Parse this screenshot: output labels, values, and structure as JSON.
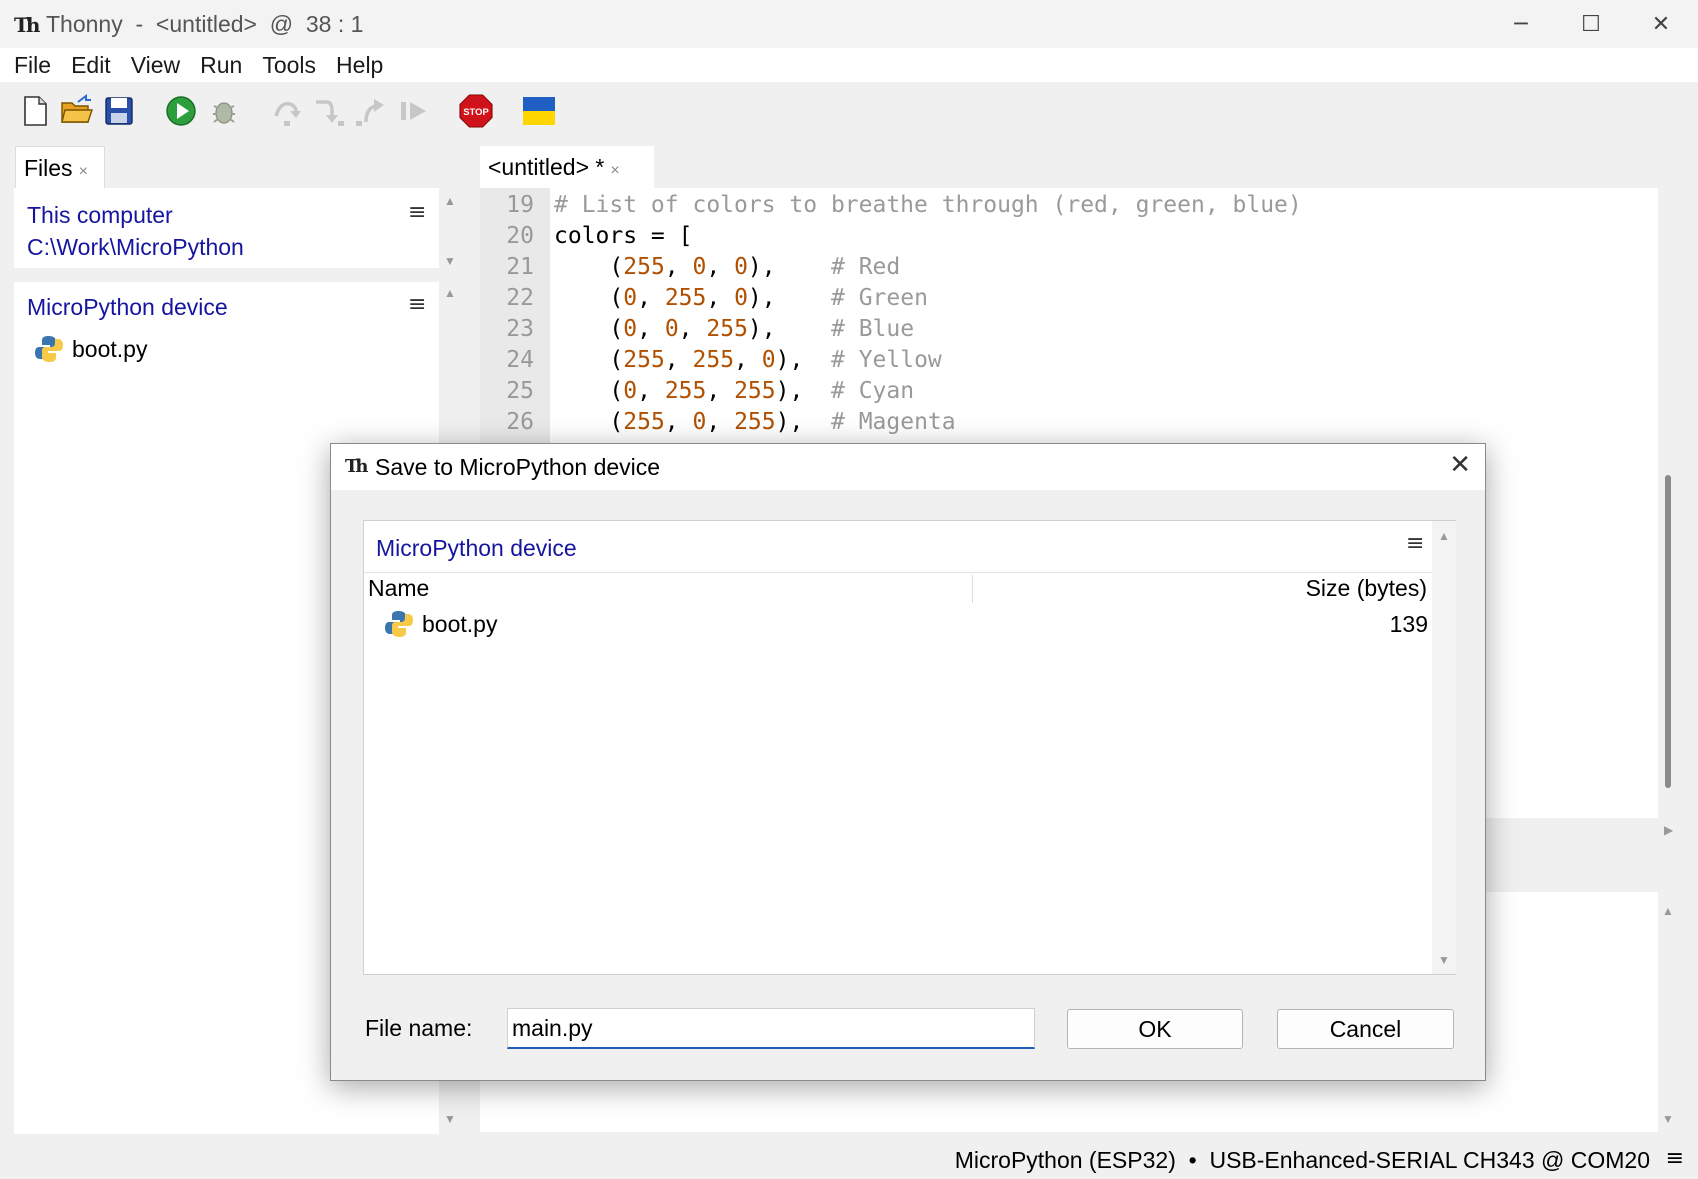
{
  "window": {
    "title": "Thonny  -  <untitled>  @  38 : 1",
    "app_icon": "Th",
    "minimize": "─",
    "maximize": "☐",
    "close": "✕"
  },
  "menu": [
    "File",
    "Edit",
    "View",
    "Run",
    "Tools",
    "Help"
  ],
  "toolbar": {
    "icons": [
      "new-file-icon",
      "open-folder-icon",
      "save-icon",
      "run-icon",
      "debug-icon",
      "step-over-icon",
      "step-into-icon",
      "step-out-icon",
      "resume-icon",
      "stop-icon",
      "ukraine-flag-icon"
    ],
    "stop_label": "STOP"
  },
  "files": {
    "tab_label": "Files",
    "tab_close": "×",
    "this_computer_label": "This computer",
    "this_computer_path": "C:\\Work\\MicroPython",
    "device_label": "MicroPython device",
    "menu_glyph": "≡",
    "items": [
      {
        "name": "boot.py",
        "icon": "python-file-icon"
      }
    ]
  },
  "editor": {
    "tab_label": "<untitled> *",
    "tab_close": "×",
    "lines": [
      {
        "n": "19",
        "parts": [
          {
            "t": "# List of colors to breathe through (red, green, blue)",
            "c": "cm"
          }
        ]
      },
      {
        "n": "20",
        "parts": [
          {
            "t": "colors = [",
            "c": ""
          }
        ]
      },
      {
        "n": "21",
        "parts": [
          {
            "t": "    (",
            "c": ""
          },
          {
            "t": "255",
            "c": "num"
          },
          {
            "t": ", ",
            "c": ""
          },
          {
            "t": "0",
            "c": "num"
          },
          {
            "t": ", ",
            "c": ""
          },
          {
            "t": "0",
            "c": "num"
          },
          {
            "t": "),    ",
            "c": ""
          },
          {
            "t": "# Red",
            "c": "cm"
          }
        ]
      },
      {
        "n": "22",
        "parts": [
          {
            "t": "    (",
            "c": ""
          },
          {
            "t": "0",
            "c": "num"
          },
          {
            "t": ", ",
            "c": ""
          },
          {
            "t": "255",
            "c": "num"
          },
          {
            "t": ", ",
            "c": ""
          },
          {
            "t": "0",
            "c": "num"
          },
          {
            "t": "),    ",
            "c": ""
          },
          {
            "t": "# Green",
            "c": "cm"
          }
        ]
      },
      {
        "n": "23",
        "parts": [
          {
            "t": "    (",
            "c": ""
          },
          {
            "t": "0",
            "c": "num"
          },
          {
            "t": ", ",
            "c": ""
          },
          {
            "t": "0",
            "c": "num"
          },
          {
            "t": ", ",
            "c": ""
          },
          {
            "t": "255",
            "c": "num"
          },
          {
            "t": "),    ",
            "c": ""
          },
          {
            "t": "# Blue",
            "c": "cm"
          }
        ]
      },
      {
        "n": "24",
        "parts": [
          {
            "t": "    (",
            "c": ""
          },
          {
            "t": "255",
            "c": "num"
          },
          {
            "t": ", ",
            "c": ""
          },
          {
            "t": "255",
            "c": "num"
          },
          {
            "t": ", ",
            "c": ""
          },
          {
            "t": "0",
            "c": "num"
          },
          {
            "t": "),  ",
            "c": ""
          },
          {
            "t": "# Yellow",
            "c": "cm"
          }
        ]
      },
      {
        "n": "25",
        "parts": [
          {
            "t": "    (",
            "c": ""
          },
          {
            "t": "0",
            "c": "num"
          },
          {
            "t": ", ",
            "c": ""
          },
          {
            "t": "255",
            "c": "num"
          },
          {
            "t": ", ",
            "c": ""
          },
          {
            "t": "255",
            "c": "num"
          },
          {
            "t": "),  ",
            "c": ""
          },
          {
            "t": "# Cyan",
            "c": "cm"
          }
        ]
      },
      {
        "n": "26",
        "parts": [
          {
            "t": "    (",
            "c": ""
          },
          {
            "t": "255",
            "c": "num"
          },
          {
            "t": ", ",
            "c": ""
          },
          {
            "t": "0",
            "c": "num"
          },
          {
            "t": ", ",
            "c": ""
          },
          {
            "t": "255",
            "c": "num"
          },
          {
            "t": "),  ",
            "c": ""
          },
          {
            "t": "# Magenta",
            "c": "cm"
          }
        ]
      }
    ]
  },
  "dialog": {
    "title": "Save to MicroPython device",
    "close": "✕",
    "location_label": "MicroPython device",
    "menu_glyph": "≡",
    "columns": {
      "name": "Name",
      "size": "Size (bytes)"
    },
    "rows": [
      {
        "name": "boot.py",
        "size": "139",
        "icon": "python-file-icon"
      }
    ],
    "file_name_label": "File name:",
    "file_name_value": "main.py",
    "ok_label": "OK",
    "cancel_label": "Cancel"
  },
  "status": {
    "text": "MicroPython (ESP32)  •  USB-Enhanced-SERIAL CH343 @ COM20",
    "menu_glyph": "≡"
  },
  "colors": {
    "link_blue": "#1515a0",
    "comment": "#9a9a9a",
    "number": "#b05000",
    "input_focus": "#1a5fb4"
  }
}
